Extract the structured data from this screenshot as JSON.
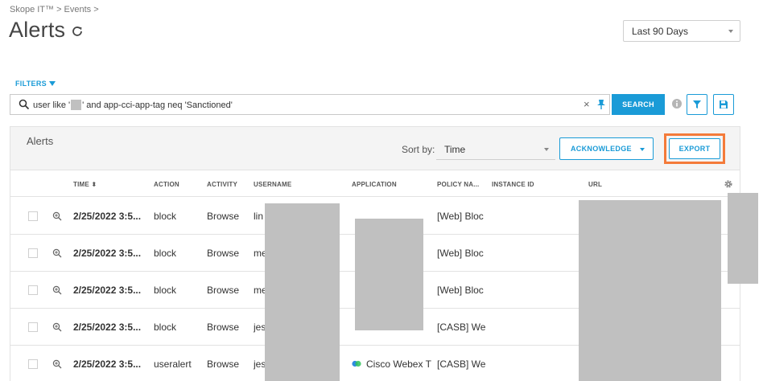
{
  "breadcrumb": "Skope IT™ > Events >",
  "page": {
    "title": "Alerts"
  },
  "time_range": {
    "selected": "Last 90 Days"
  },
  "filters": {
    "label": "FILTERS"
  },
  "search": {
    "query_prefix": "user like '",
    "query_suffix": "' and app-cci-app-tag neq 'Sanctioned'",
    "clear_glyph": "×",
    "button_label": "SEARCH"
  },
  "panel": {
    "title": "Alerts",
    "sort_label": "Sort by:",
    "sort_value": "Time",
    "acknowledge_label": "ACKNOWLEDGE",
    "export_label": "EXPORT"
  },
  "columns": {
    "time": "TIME ⬍",
    "action": "ACTION",
    "activity": "ACTIVITY",
    "username": "USERNAME",
    "application": "APPLICATION",
    "policy_name": "POLICY NA...",
    "instance_id": "INSTANCE ID",
    "url": "URL"
  },
  "rows": [
    {
      "time": "2/25/2022 3:5...",
      "action": "block",
      "activity": "Browse",
      "username": "lin",
      "application": "",
      "policy": "[Web] Bloc"
    },
    {
      "time": "2/25/2022 3:5...",
      "action": "block",
      "activity": "Browse",
      "username": "me",
      "application": "",
      "policy": "[Web] Bloc"
    },
    {
      "time": "2/25/2022 3:5...",
      "action": "block",
      "activity": "Browse",
      "username": "me",
      "application": "",
      "policy": "[Web] Bloc"
    },
    {
      "time": "2/25/2022 3:5...",
      "action": "block",
      "activity": "Browse",
      "username": "jes",
      "application": "",
      "policy": "[CASB] We"
    },
    {
      "time": "2/25/2022 3:5...",
      "action": "useralert",
      "activity": "Browse",
      "username": "jes",
      "application": "Cisco Webex T",
      "policy": "[CASB] We"
    }
  ],
  "colors": {
    "accent": "#1a9bd7",
    "highlight": "#f47b3a",
    "redaction": "#c0c0c0"
  }
}
